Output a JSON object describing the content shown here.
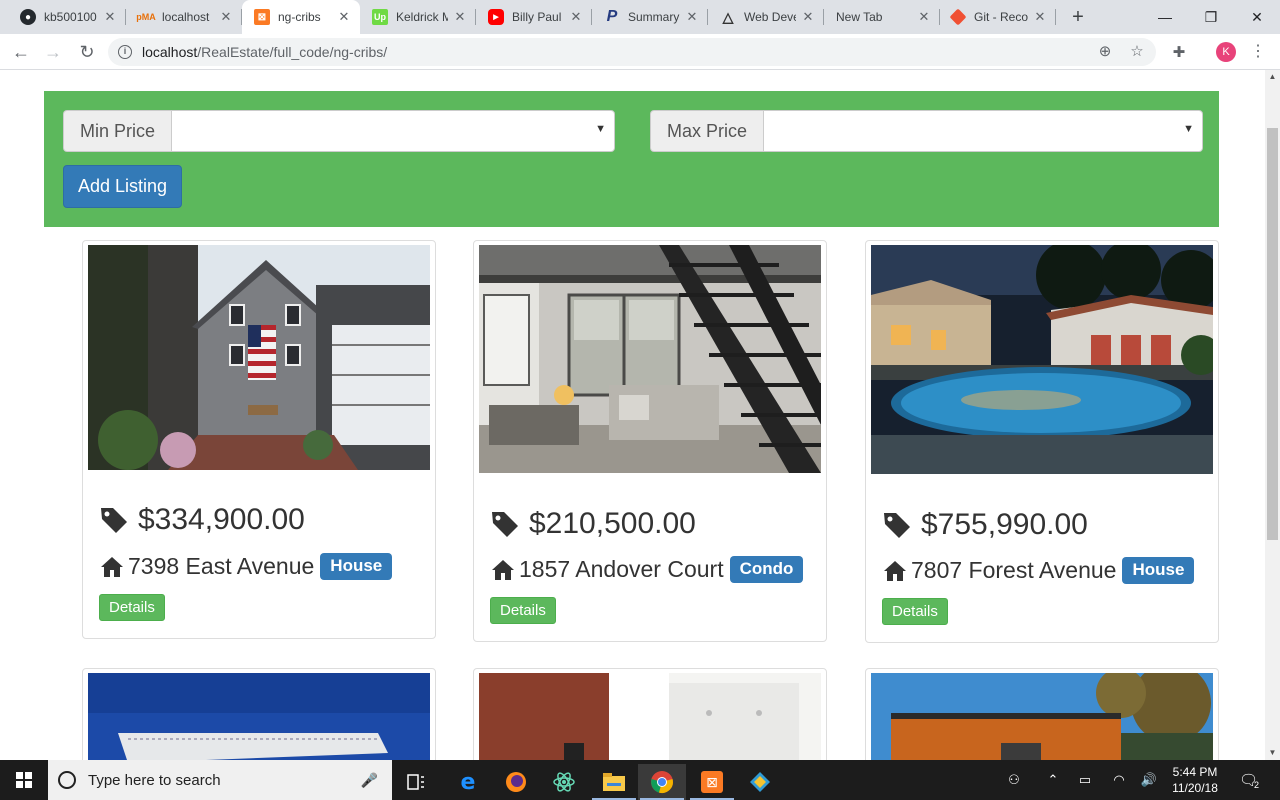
{
  "browser": {
    "tabs": [
      {
        "title": "kb500100",
        "favicon": "github-icon"
      },
      {
        "title": "localhost",
        "favicon": "phpmyadmin-icon"
      },
      {
        "title": "ng-cribs",
        "favicon": "xampp-icon",
        "active": true
      },
      {
        "title": "Keldrick M",
        "favicon": "upwork-icon"
      },
      {
        "title": "Billy Paul",
        "favicon": "youtube-icon"
      },
      {
        "title": "Summary",
        "favicon": "paypal-icon"
      },
      {
        "title": "Web Deve",
        "favicon": "triangle-logo-icon"
      },
      {
        "title": "New Tab",
        "favicon": ""
      },
      {
        "title": "Git - Reco",
        "favicon": "git-icon"
      }
    ],
    "url_host": "localhost",
    "url_path": "/RealEstate/full_code/ng-cribs/",
    "profile_initial": "K"
  },
  "filters": {
    "min_label": "Min Price",
    "max_label": "Max Price",
    "min_value": "",
    "max_value": "",
    "add_label": "Add Listing"
  },
  "listings": [
    {
      "price": "$334,900.00",
      "address": "7398 East Avenue",
      "type": "House",
      "details_label": "Details"
    },
    {
      "price": "$210,500.00",
      "address": "1857 Andover Court",
      "type": "Condo",
      "details_label": "Details"
    },
    {
      "price": "$755,990.00",
      "address": "7807 Forest Avenue",
      "type": "House",
      "details_label": "Details"
    }
  ],
  "taskbar": {
    "search_placeholder": "Type here to search",
    "time": "5:44 PM",
    "date": "11/20/18",
    "notification_count": "2"
  },
  "colors": {
    "filter_bar": "#5cb85c",
    "primary": "#337ab7",
    "success": "#5cb85c"
  }
}
